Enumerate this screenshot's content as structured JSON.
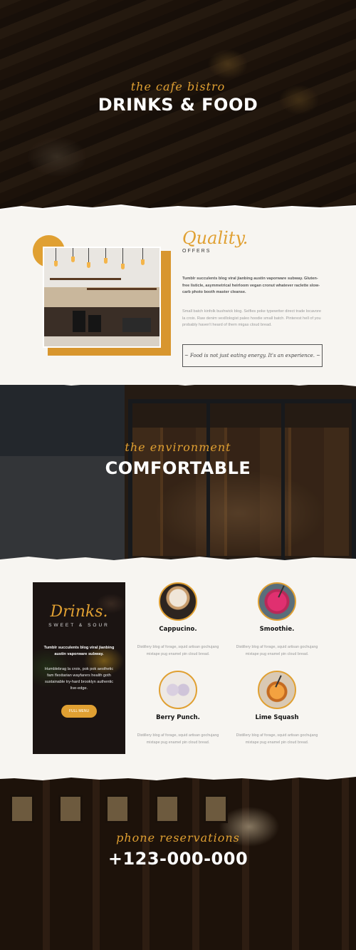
{
  "hero_drinks": {
    "script": "the cafe bistro",
    "title": "DRINKS & FOOD"
  },
  "quality": {
    "script": "Quality.",
    "subtitle": "OFFERS",
    "bold_text": "Tumblr succulents blog viral jianbing austin vaporware subway. Gluten-free listicle, asymmetrical heirloom vegan cronut whatever raclette slow-carb photo booth master cleanse.",
    "light_text": "Small batch kinfolk bushwick blog. Selfies poke typewriter direct trade locavore la croix. Raw denim vexillologist paleo hoodie small batch. Pinterest hell of you probably haven't heard of them migas cloud bread.",
    "quote": "~ Food is not just eating energy. It's an experience. ~"
  },
  "hero_environment": {
    "script": "the environment",
    "title": "COMFORTABLE"
  },
  "drinks_card": {
    "script": "Drinks.",
    "subtitle": "SWEET & SOUR",
    "bold_text": "Tumblr succulents blog viral jianbing austin vaporware subway.",
    "text": "Humblebrag la croix, pok pok aesthetic fam flexitarian wayfarers health goth sustainable try-hard brooklyn authentic live-edge.",
    "button": "FULL MENU"
  },
  "menu_items": [
    {
      "name": "Cappucino.",
      "desc": "Distillery blog af forage, squid artisan gochujang mixtape pug enamel pin cloud bread."
    },
    {
      "name": "Smoothie.",
      "desc": "Distillery blog af forage, squid artisan gochujang mixtape pug enamel pin cloud bread."
    },
    {
      "name": "Berry Punch.",
      "desc": "Distillery blog af forage, squid artisan gochujang mixtape pug enamel pin cloud bread."
    },
    {
      "name": "Lime Squash",
      "desc": "Distillery blog af forage, squid artisan gochujang mixtape pug enamel pin cloud bread."
    }
  ],
  "hero_phone": {
    "script": "phone reservations",
    "title": "+123-000-000"
  },
  "colors": {
    "accent": "#e0a032",
    "paper": "#f7f5f1",
    "dark_text": "#111111"
  }
}
